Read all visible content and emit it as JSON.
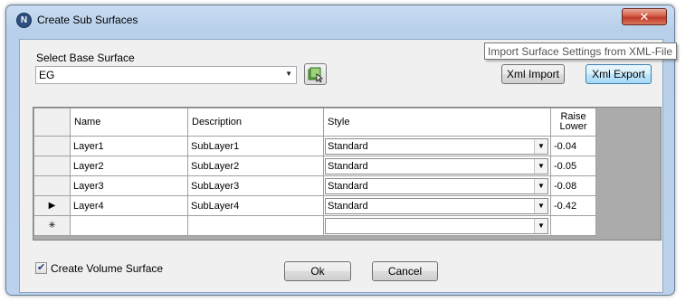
{
  "window": {
    "title": "Create Sub Surfaces",
    "app_icon_letter": "N",
    "close_glyph": "✕"
  },
  "base_surface": {
    "label": "Select Base Surface",
    "value": "EG"
  },
  "buttons": {
    "xml_import": "Xml Import",
    "xml_export": "Xml Export",
    "ok": "Ok",
    "cancel": "Cancel"
  },
  "tooltip": "Import Surface Settings from XML-File",
  "grid": {
    "columns": {
      "name": "Name",
      "description": "Description",
      "style": "Style",
      "raise_line1": "Raise",
      "raise_line2": "Lower"
    },
    "rows": [
      {
        "indicator": "",
        "name": "Layer1",
        "description": "SubLayer1",
        "style": "Standard",
        "raise_lower": "-0.04"
      },
      {
        "indicator": "",
        "name": "Layer2",
        "description": "SubLayer2",
        "style": "Standard",
        "raise_lower": "-0.05"
      },
      {
        "indicator": "",
        "name": "Layer3",
        "description": "SubLayer3",
        "style": "Standard",
        "raise_lower": "-0.08"
      },
      {
        "indicator": "▶",
        "name": "Layer4",
        "description": "SubLayer4",
        "style": "Standard",
        "raise_lower": "-0.42"
      }
    ],
    "new_row": {
      "indicator": "✳",
      "name": "",
      "description": "",
      "style": "",
      "raise_lower": ""
    }
  },
  "volume_surface": {
    "label": "Create Volume Surface",
    "checked": true
  },
  "colors": {
    "title_bar": "#b9d0ea",
    "close_button": "#c0392b",
    "grid_background": "#ababab",
    "hot_button": "#bee6fd"
  },
  "icons": {
    "app": "app-logo-icon",
    "combo_arrow": "chevron-down-icon",
    "pick": "pick-surface-icon",
    "close": "close-icon"
  }
}
